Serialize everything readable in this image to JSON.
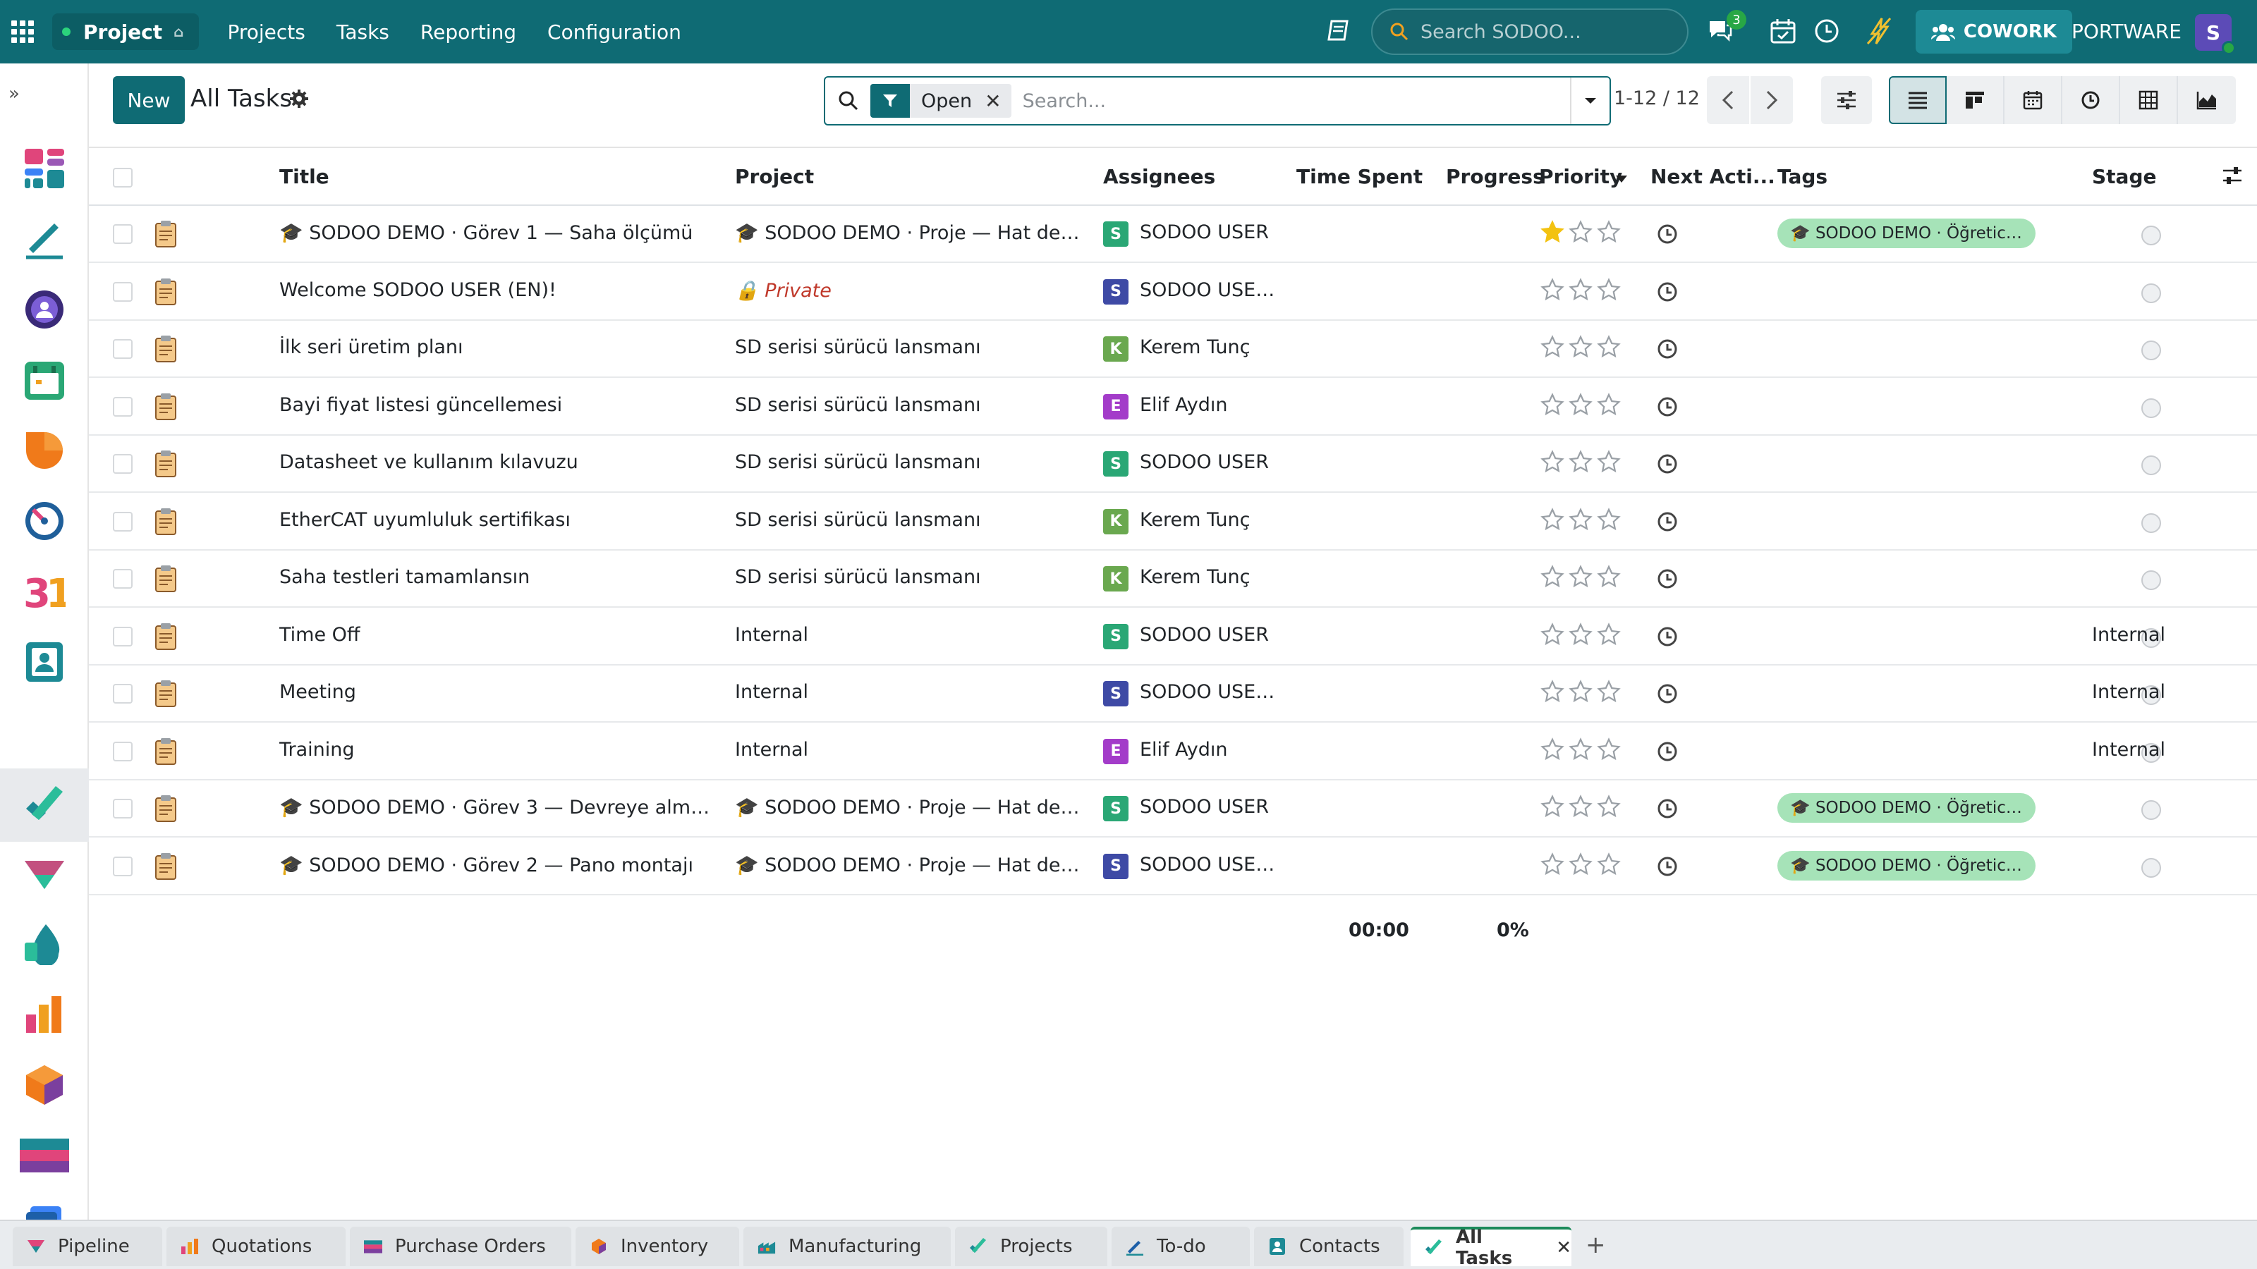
{
  "navbar": {
    "app_name": "Project",
    "menu": [
      "Projects",
      "Tasks",
      "Reporting",
      "Configuration"
    ],
    "search_placeholder": "Search SODOO...",
    "chat_badge": "3",
    "cowork_label": "COWORK",
    "company": "PORTWARE",
    "user_initial": "S"
  },
  "control_panel": {
    "new_label": "New",
    "title": "All Tasks",
    "facet_label": "Open",
    "search_placeholder": "Search...",
    "pager": "1-12 / 12"
  },
  "columns": {
    "title": "Title",
    "project": "Project",
    "assignees": "Assignees",
    "time_spent": "Time Spent",
    "progress": "Progress",
    "priority": "Priority",
    "next_activity": "Next Acti...",
    "tags": "Tags",
    "stage": "Stage"
  },
  "rows": [
    {
      "title": "🎓 SODOO DEMO · Görev 1 — Saha ölçümü",
      "project": "🎓 SODOO DEMO · Proje — Hat devr...",
      "assignee": "SODOO USER",
      "initial": "S",
      "av_color": "#2aa775",
      "priority": 1,
      "tag": "🎓 SODOO DEMO · Öğretici...",
      "stage": ""
    },
    {
      "title": "Welcome SODOO USER (EN)!",
      "project": "🔒 Private",
      "assignee": "SODOO USER...",
      "initial": "S",
      "av_color": "#3e4aa5",
      "priority": 0,
      "tag": "",
      "stage": "",
      "private": true
    },
    {
      "title": "İlk seri üretim planı",
      "project": "SD serisi sürücü lansmanı",
      "assignee": "Kerem Tunç",
      "initial": "K",
      "av_color": "#6aa84f",
      "priority": 0,
      "tag": "",
      "stage": ""
    },
    {
      "title": "Bayi fiyat listesi güncellemesi",
      "project": "SD serisi sürücü lansmanı",
      "assignee": "Elif Aydın",
      "initial": "E",
      "av_color": "#a33cc9",
      "priority": 0,
      "tag": "",
      "stage": ""
    },
    {
      "title": "Datasheet ve kullanım kılavuzu",
      "project": "SD serisi sürücü lansmanı",
      "assignee": "SODOO USER",
      "initial": "S",
      "av_color": "#2aa775",
      "priority": 0,
      "tag": "",
      "stage": ""
    },
    {
      "title": "EtherCAT uyumluluk sertifikası",
      "project": "SD serisi sürücü lansmanı",
      "assignee": "Kerem Tunç",
      "initial": "K",
      "av_color": "#6aa84f",
      "priority": 0,
      "tag": "",
      "stage": ""
    },
    {
      "title": "Saha testleri tamamlansın",
      "project": "SD serisi sürücü lansmanı",
      "assignee": "Kerem Tunç",
      "initial": "K",
      "av_color": "#6aa84f",
      "priority": 0,
      "tag": "",
      "stage": ""
    },
    {
      "title": "Time Off",
      "project": "Internal",
      "assignee": "SODOO USER",
      "initial": "S",
      "av_color": "#2aa775",
      "priority": 0,
      "tag": "",
      "stage": "Internal"
    },
    {
      "title": "Meeting",
      "project": "Internal",
      "assignee": "SODOO USER...",
      "initial": "S",
      "av_color": "#3e4aa5",
      "priority": 0,
      "tag": "",
      "stage": "Internal"
    },
    {
      "title": "Training",
      "project": "Internal",
      "assignee": "Elif Aydın",
      "initial": "E",
      "av_color": "#a33cc9",
      "priority": 0,
      "tag": "",
      "stage": "Internal"
    },
    {
      "title": "🎓 SODOO DEMO · Görev 3 — Devreye alma ve ...",
      "project": "🎓 SODOO DEMO · Proje — Hat devr...",
      "assignee": "SODOO USER",
      "initial": "S",
      "av_color": "#2aa775",
      "priority": 0,
      "tag": "🎓 SODOO DEMO · Öğretici...",
      "stage": ""
    },
    {
      "title": "🎓 SODOO DEMO · Görev 2 — Pano montajı",
      "project": "🎓 SODOO DEMO · Proje — Hat devr...",
      "assignee": "SODOO USER...",
      "initial": "S",
      "av_color": "#3e4aa5",
      "priority": 0,
      "tag": "🎓 SODOO DEMO · Öğretici...",
      "stage": ""
    }
  ],
  "totals": {
    "time_spent": "00:00",
    "progress": "0%"
  },
  "bottom_tabs": [
    "Pipeline",
    "Quotations",
    "Purchase Orders",
    "Inventory",
    "Manufacturing",
    "Projects",
    "To-do",
    "Contacts",
    "All Tasks"
  ],
  "colors": {
    "brand": "#0f6b74",
    "star": "#f3c211",
    "tag": "#a6e3b8"
  }
}
